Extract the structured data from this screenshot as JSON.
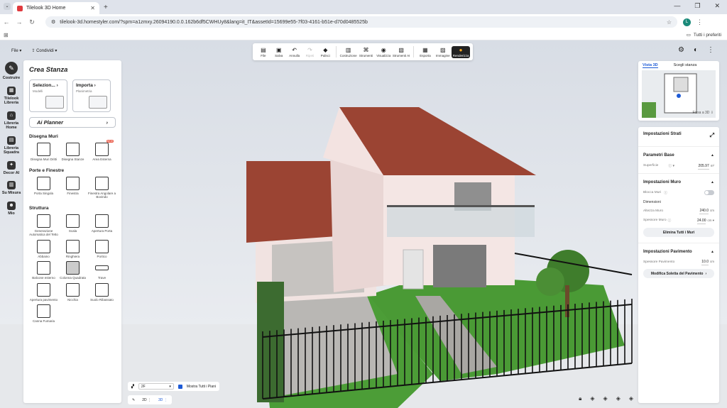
{
  "browser": {
    "tab_title": "Tilelook 3D Home",
    "url": "tilelook-3d.homestyler.com/?spm=a1zmxy.26094190.0.0.162b6df5CWHUy8&lang=it_IT&assetId=15699e55-7f03-4161-b51e-d70d0485525b",
    "bookmarks_label": "Tutti i preferiti",
    "profile_initial": "L"
  },
  "topbar": {
    "file_menu": "File",
    "share": "Condividi"
  },
  "toolbar": {
    "items": [
      {
        "label": "File",
        "icon": "folder-icon"
      },
      {
        "label": "Salva",
        "icon": "save-icon"
      },
      {
        "label": "Annulla",
        "icon": "undo-icon"
      },
      {
        "label": "Ripeti",
        "icon": "redo-icon"
      },
      {
        "label": "Pulisci",
        "icon": "eraser-icon"
      },
      {
        "label": "Costruzione",
        "icon": "build-icon"
      },
      {
        "label": "Strumenti",
        "icon": "tools-icon"
      },
      {
        "label": "Visualizza",
        "icon": "eye-icon"
      },
      {
        "label": "Strumenti AI",
        "icon": "ai-icon"
      },
      {
        "label": "Esporta",
        "icon": "export-icon"
      },
      {
        "label": "Immagine",
        "icon": "image-icon"
      },
      {
        "label": "Renderizza",
        "icon": "render-icon"
      }
    ]
  },
  "rail": {
    "items": [
      {
        "label": "Costruire",
        "icon": "compass-icon"
      },
      {
        "label": "Tilelook Libreria",
        "icon": "tile-icon"
      },
      {
        "label": "Libreria Home",
        "icon": "home-library-icon"
      },
      {
        "label": "Libreria Squadra",
        "icon": "team-library-icon"
      },
      {
        "label": "Decor AI",
        "icon": "decor-ai-icon"
      },
      {
        "label": "Su Misura",
        "icon": "custom-icon"
      },
      {
        "label": "Mio",
        "icon": "user-icon"
      }
    ]
  },
  "left_panel": {
    "title": "Crea Stanza",
    "cards": [
      {
        "title": "Selezion...",
        "subtitle": "Modelli"
      },
      {
        "title": "Importa",
        "subtitle": "Planimetria"
      }
    ],
    "ai_planner": "Ai Planner",
    "sections": [
      {
        "title": "Disegna Muri",
        "items": [
          "Disegna Muri Dritti",
          "Disegna Stanze",
          "Area Esterna"
        ]
      },
      {
        "title": "Porte e Finestre",
        "items": [
          "Porta Singola",
          "Finestra",
          "Finestra Angolare a Bovindo"
        ]
      },
      {
        "title": "Struttura",
        "items": [
          "Generazione Automatica del Tetto",
          "Scala",
          "Apertura Porta",
          "Abbaino",
          "Ringhiera",
          "Portico",
          "Balcone esterno",
          "Colonna Quadrata",
          "Trave",
          "Apertura pavimento",
          "Nicchia",
          "Suolo Ribassato",
          "Canna Fumaria"
        ]
      }
    ],
    "new_badge": "NEW"
  },
  "right_panel": {
    "view_tabs": [
      "Vista 3D",
      "Scegli stanza"
    ],
    "fit": "Fissa a 3D",
    "title": "Impostazioni Strati",
    "base_params": "Parametri Base",
    "surface_label": "Superficie",
    "surface_value": "205.97",
    "surface_unit": "m²",
    "wall_settings": "Impostazioni Muro",
    "lock_walls": "Blocca Muri",
    "dimensions": "Dimensioni",
    "wall_height_label": "Altezza Muro",
    "wall_height_value": "240.0",
    "wall_thickness_label": "Spessore Muro",
    "wall_thickness_value": "24.00",
    "unit_cm": "cm",
    "delete_walls": "Elimina Tutti i Muri",
    "floor_settings": "Impostazioni Pavimento",
    "floor_thickness_label": "Spessore Pavimento",
    "floor_thickness_value": "10.0",
    "edit_slab": "Modifica Soletta del Pavimento"
  },
  "bottom": {
    "floor_select": "2F",
    "show_all_floors": "Mostra Tutti i Piani",
    "view_2d": "2D",
    "view_3d": "3D"
  },
  "colors": {
    "accent": "#1e5bd6",
    "roof": "#9b4433",
    "wall": "#f3e4e2",
    "grass": "#4a9a35"
  }
}
